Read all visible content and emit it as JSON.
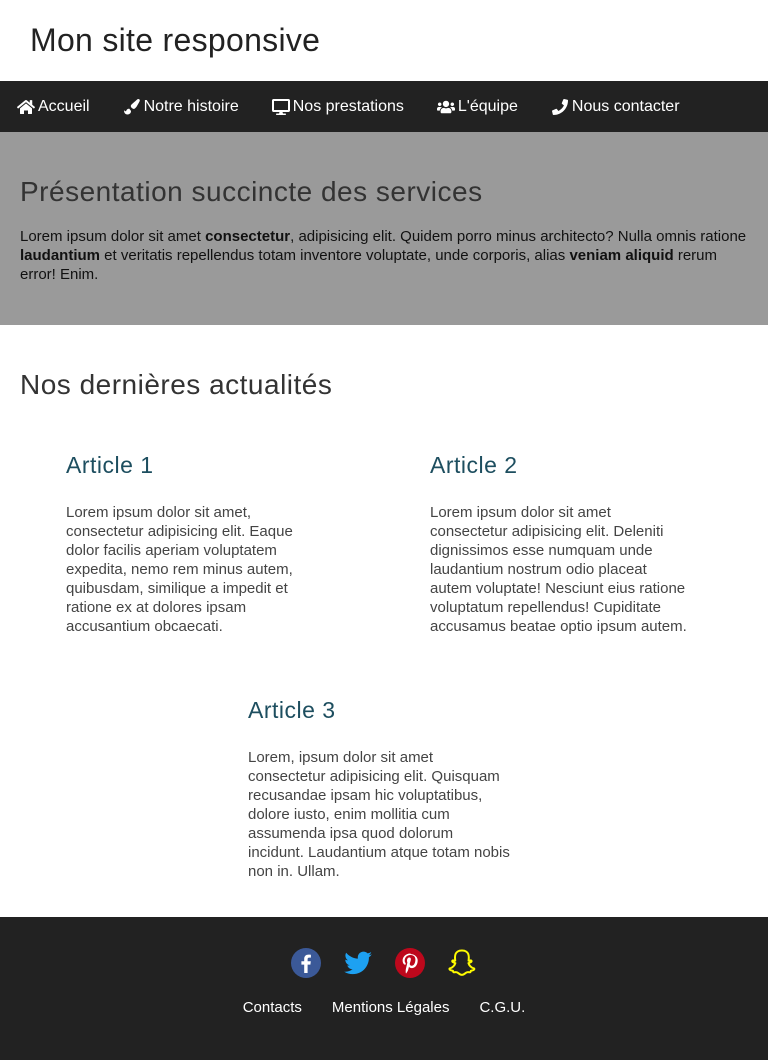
{
  "header": {
    "title": "Mon site responsive"
  },
  "nav": {
    "items": [
      {
        "label": "Accueil",
        "icon": "home-icon"
      },
      {
        "label": "Notre histoire",
        "icon": "paintbrush-icon"
      },
      {
        "label": "Nos prestations",
        "icon": "desktop-icon"
      },
      {
        "label": "L'équipe",
        "icon": "users-icon"
      },
      {
        "label": "Nous contacter",
        "icon": "phone-icon"
      }
    ]
  },
  "services": {
    "title": "Présentation succincte des services",
    "p1": "Lorem ipsum dolor sit amet ",
    "b1": "consectetur",
    "p2": ", adipisicing elit. Quidem porro minus architecto? Nulla omnis ratione ",
    "b2": "laudantium",
    "p3": " et veritatis repellendus totam inventore voluptate, unde corporis, alias ",
    "b3": "veniam aliquid",
    "p4": " rerum error! Enim."
  },
  "news": {
    "title": "Nos dernières actualités",
    "articles": [
      {
        "title": "Article 1",
        "text": "Lorem ipsum dolor sit amet, consectetur adipisicing elit. Eaque dolor facilis aperiam voluptatem expedita, nemo rem minus autem, quibusdam, similique a impedit et ratione ex at dolores ipsam accusantium obcaecati."
      },
      {
        "title": "Article 2",
        "text": "Lorem ipsum dolor sit amet consectetur adipisicing elit. Deleniti dignissimos esse numquam unde laudantium nostrum odio placeat autem voluptate! Nesciunt eius ratione voluptatum repellendus! Cupiditate accusamus beatae optio ipsum autem."
      },
      {
        "title": "Article 3",
        "text": "Lorem, ipsum dolor sit amet consectetur adipisicing elit. Quisquam recusandae ipsam hic voluptatibus, dolore iusto, enim mollitia cum assumenda ipsa quod dolorum incidunt. Laudantium atque totam nobis non in. Ullam."
      }
    ]
  },
  "footer": {
    "social": [
      {
        "icon": "facebook-icon",
        "color": "#3b5998"
      },
      {
        "icon": "twitter-icon",
        "color": "#1da1f2"
      },
      {
        "icon": "pinterest-icon",
        "color": "#bd081c"
      },
      {
        "icon": "snapchat-icon",
        "color": "#fffc00"
      }
    ],
    "links": [
      "Contacts",
      "Mentions Légales",
      "C.G.U."
    ]
  },
  "colors": {
    "nav_bg": "#222222",
    "services_bg": "#9a9a9a",
    "article_title": "#1d4e5f",
    "footer_bg": "#222222"
  }
}
